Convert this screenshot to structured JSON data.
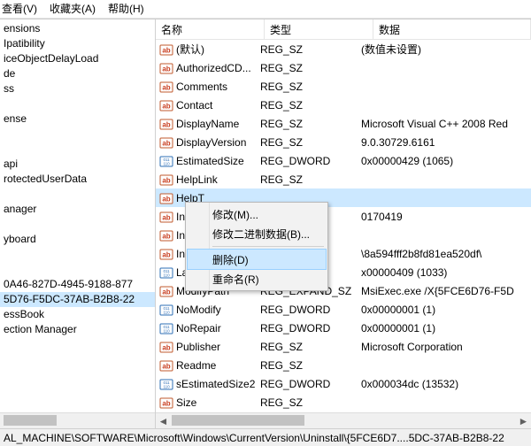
{
  "menu": {
    "view": "查看(V)",
    "fav": "收藏夹(A)",
    "help": "帮助(H)"
  },
  "treeItems": [
    "ensions",
    "Ipatibility",
    "iceObjectDelayLoad",
    "de",
    "ss",
    "",
    "ense",
    "",
    "",
    "api",
    "rotectedUserData",
    "",
    "anager",
    "",
    "yboard",
    "",
    "",
    "0A46-827D-4945-9188-877",
    "5D76-F5DC-37AB-B2B8-22",
    "essBook",
    "ection Manager"
  ],
  "treeSelIndex": 18,
  "columns": {
    "c0": "名称",
    "c1": "类型",
    "c2": "数据"
  },
  "rows": [
    {
      "icon": "str",
      "name": "(默认)",
      "type": "REG_SZ",
      "data": "(数值未设置)"
    },
    {
      "icon": "str",
      "name": "AuthorizedCD...",
      "type": "REG_SZ",
      "data": ""
    },
    {
      "icon": "str",
      "name": "Comments",
      "type": "REG_SZ",
      "data": ""
    },
    {
      "icon": "str",
      "name": "Contact",
      "type": "REG_SZ",
      "data": ""
    },
    {
      "icon": "str",
      "name": "DisplayName",
      "type": "REG_SZ",
      "data": "Microsoft Visual C++ 2008 Red"
    },
    {
      "icon": "str",
      "name": "DisplayVersion",
      "type": "REG_SZ",
      "data": "9.0.30729.6161"
    },
    {
      "icon": "bin",
      "name": "EstimatedSize",
      "type": "REG_DWORD",
      "data": "0x00000429 (1065)"
    },
    {
      "icon": "str",
      "name": "HelpLink",
      "type": "REG_SZ",
      "data": ""
    },
    {
      "icon": "str",
      "name": "HelpT",
      "type": "",
      "data": "",
      "sel": true
    },
    {
      "icon": "str",
      "name": "Install",
      "type": "",
      "data": "0170419"
    },
    {
      "icon": "str",
      "name": "Install",
      "type": "",
      "data": ""
    },
    {
      "icon": "str",
      "name": "Install",
      "type": "",
      "data": "\\8a594fff2b8fd81ea520df\\"
    },
    {
      "icon": "bin",
      "name": "Langu",
      "type": "",
      "data": "x00000409 (1033)"
    },
    {
      "icon": "str",
      "name": "ModifyPath",
      "type": "REG_EXPAND_SZ",
      "data": "MsiExec.exe /X{5FCE6D76-F5D"
    },
    {
      "icon": "bin",
      "name": "NoModify",
      "type": "REG_DWORD",
      "data": "0x00000001 (1)"
    },
    {
      "icon": "bin",
      "name": "NoRepair",
      "type": "REG_DWORD",
      "data": "0x00000001 (1)"
    },
    {
      "icon": "str",
      "name": "Publisher",
      "type": "REG_SZ",
      "data": "Microsoft Corporation"
    },
    {
      "icon": "str",
      "name": "Readme",
      "type": "REG_SZ",
      "data": ""
    },
    {
      "icon": "bin",
      "name": "sEstimatedSize2",
      "type": "REG_DWORD",
      "data": "0x000034dc (13532)"
    },
    {
      "icon": "str",
      "name": "Size",
      "type": "REG_SZ",
      "data": ""
    }
  ],
  "ctx": {
    "modify": "修改(M)...",
    "modifyBin": "修改二进制数据(B)...",
    "delete": "删除(D)",
    "rename": "重命名(R)"
  },
  "status": "AL_MACHINE\\SOFTWARE\\Microsoft\\Windows\\CurrentVersion\\Uninstall\\{5FCE6D7....5DC-37AB-B2B8-22"
}
